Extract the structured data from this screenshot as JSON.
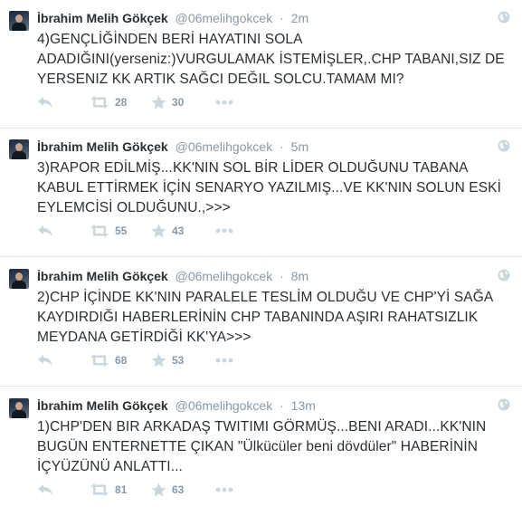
{
  "colors": {
    "meta": "#8899a6",
    "text": "#292f33",
    "icon": "#ccd6dd",
    "divider": "#e1e8ed"
  },
  "icons": [
    "avatar",
    "globe-icon",
    "reply-icon",
    "retweet-icon",
    "star-icon",
    "more-icon"
  ],
  "tweets": [
    {
      "fullname": "İbrahim Melih Gökçek",
      "username": "@06melihgokcek",
      "separator": "·",
      "time": "2m",
      "text": "4)GENÇLİĞİNDEN BERİ HAYATINI SOLA ADADIĞINI(yerseniz:)VURGULAMAK İSTEMİŞLER,.CHP TABANI,SIZ DE YERSENIZ KK ARTIK SAĞCI DEĞIL SOLCU.TAMAM MI?",
      "retweets": "28",
      "favorites": "30"
    },
    {
      "fullname": "İbrahim Melih Gökçek",
      "username": "@06melihgokcek",
      "separator": "·",
      "time": "5m",
      "text": "3)RAPOR EDİLMİŞ...KK'NIN SOL BİR LİDER OLDUĞUNU TABANA KABUL ETTİRMEK İÇİN SENARYO YAZILMIŞ...VE KK'NIN SOLUN ESKİ EYLEMCİSİ OLDUĞUNU.,>>>",
      "retweets": "55",
      "favorites": "43"
    },
    {
      "fullname": "İbrahim Melih Gökçek",
      "username": "@06melihgokcek",
      "separator": "·",
      "time": "8m",
      "text": "2)CHP İÇİNDE KK'NIN PARALELE TESLİM OLDUĞU VE CHP'Yİ SAĞA KAYDIRDIĞI HABERLERİNİN CHP TABANINDA AŞIRI RAHATSIZLIK MEYDANA GETİRDİĞİ KK'YA>>>",
      "retweets": "68",
      "favorites": "53"
    },
    {
      "fullname": "İbrahim Melih Gökçek",
      "username": "@06melihgokcek",
      "separator": "·",
      "time": "13m",
      "text": "1)CHP'DEN BIR ARKADAŞ TWITIMI GÖRMÜŞ...BENI ARADI...KK'NIN BUGÜN ENTERNETTE ÇIKAN \"Ülkücüler beni dövdüler\" HABERİNİN İÇYÜZÜNÜ ANLATTI...",
      "retweets": "81",
      "favorites": "63"
    }
  ]
}
